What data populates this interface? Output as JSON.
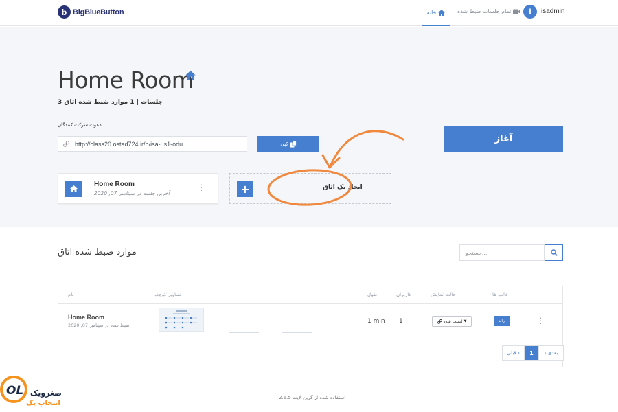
{
  "navbar": {
    "logo_letter": "b",
    "logo_text": "BigBlueButton",
    "home_label": "خانه",
    "recordings_label": "تمام جلسات ضبط شده",
    "avatar_letter": "i",
    "username": "isadmin"
  },
  "room": {
    "title": "Home Room",
    "meta": "جلسات | 1 موارد ضبط شده اتاق 3",
    "invite_label": "دعوت شرکت کنندگان",
    "url": "http://class20.ostad724.ir/b/isa-us1-odu",
    "copy_label": "کپی",
    "start_label": "آغاز"
  },
  "room_card": {
    "title": "Home Room",
    "subtitle": "آخرین جلسه در سپتامبر 07, 2020"
  },
  "create_room": {
    "label": "ایجاد یک اتاق"
  },
  "recordings": {
    "title": "موارد ضبط شده اتاق",
    "search_placeholder": "جستجو...",
    "columns": {
      "name": "نام",
      "thumbnails": "تصاویر کوچک",
      "length": "طول",
      "users": "کاربران",
      "visibility": "حالت نمایش",
      "formats": "قالب ها"
    },
    "rows": [
      {
        "name": "Home Room",
        "date": "ضبط شده در سپتامبر 07, 2020",
        "length": "1 min",
        "users": "1",
        "visibility": "لیست شده",
        "format": "ارائه"
      }
    ],
    "pagination": {
      "prev": "قبلی ›",
      "page": "1",
      "next": "‹ بعدی"
    }
  },
  "footer": {
    "text": "استفاده شده از گرین لایت 2.6.5"
  },
  "watermark": {
    "brand": "صغرویک",
    "sub": "انتخاب پک",
    "logo_text": "OL"
  },
  "colors": {
    "primary": "#467fcf",
    "logo_navy": "#283274",
    "hero_bg": "#f4f6f9",
    "annotation_orange": "#f0883e"
  }
}
